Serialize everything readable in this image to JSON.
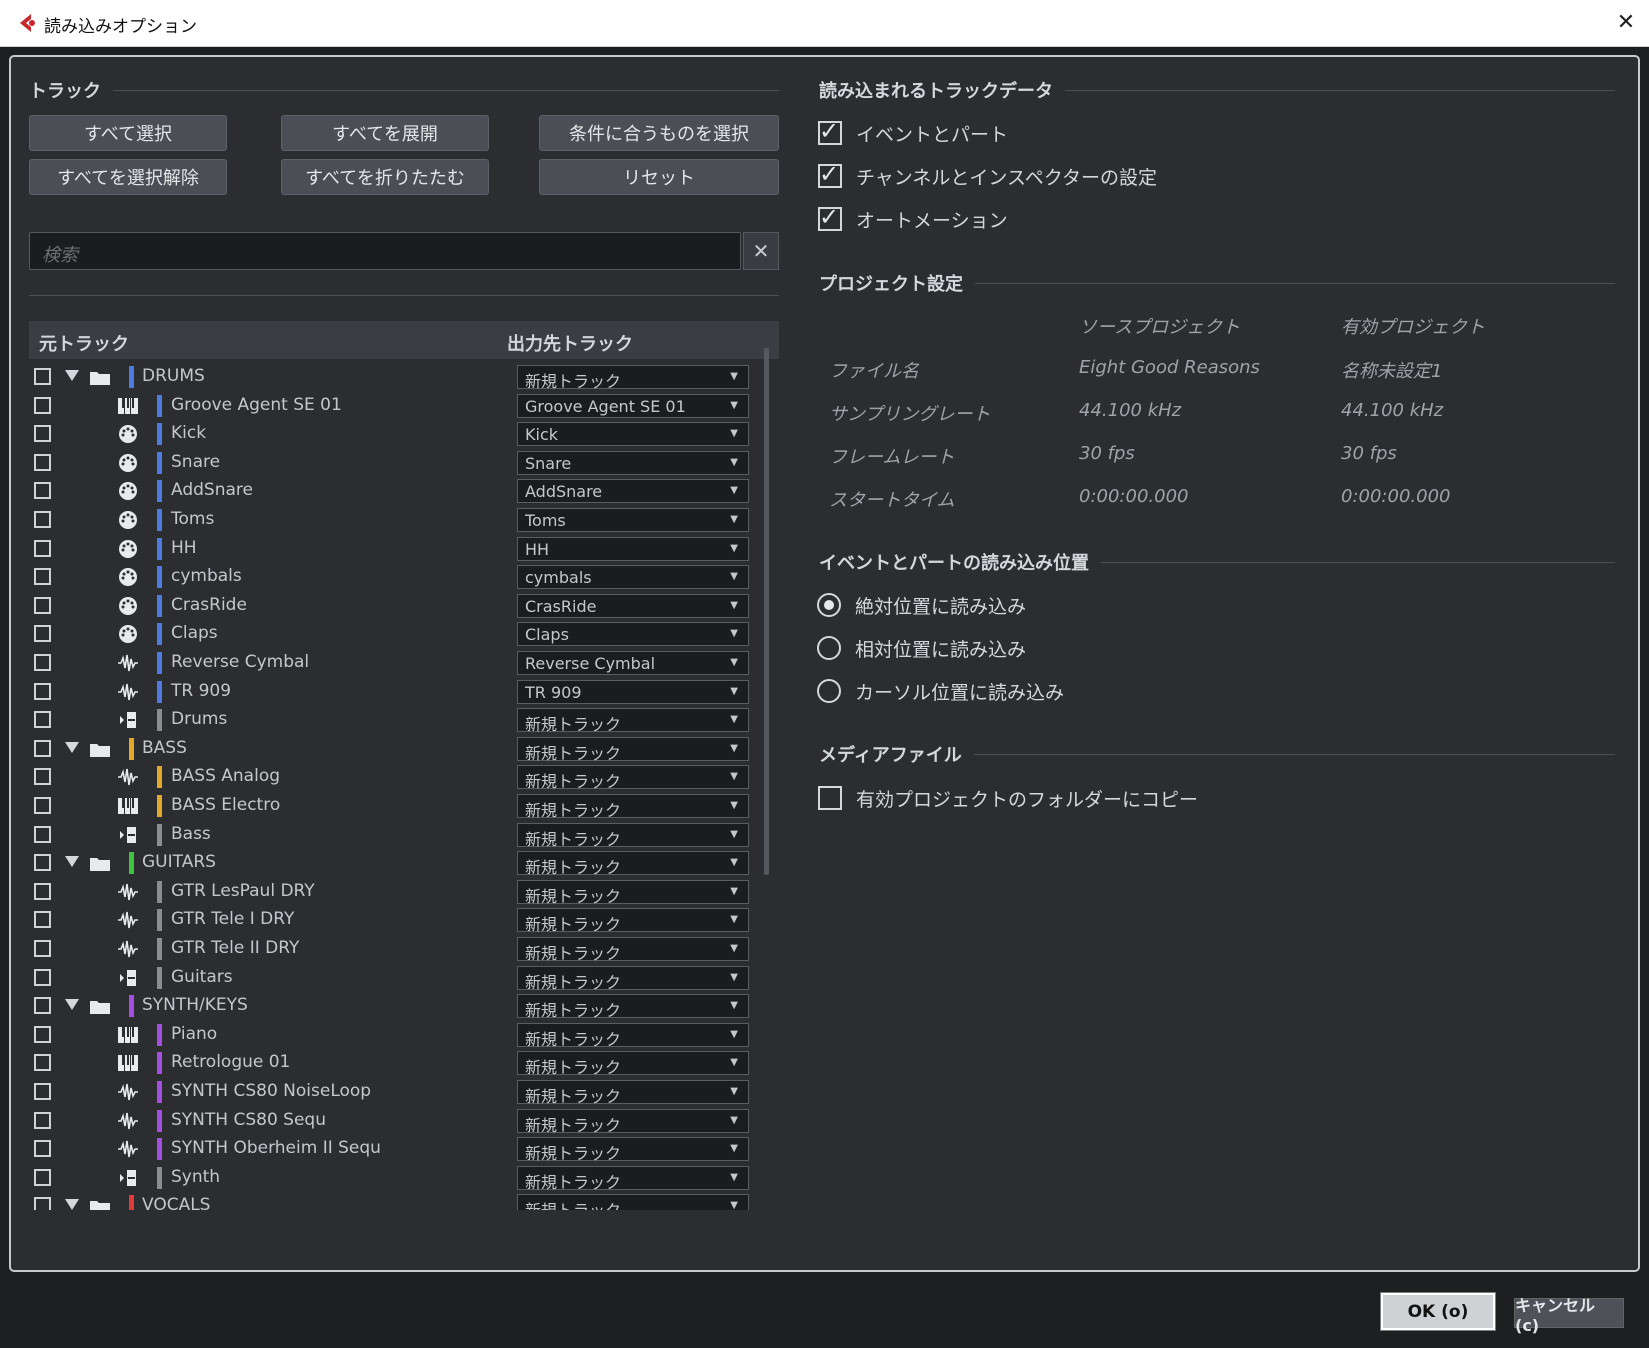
{
  "window": {
    "title": "読み込みオプション",
    "close_label": "✕"
  },
  "tracks_section": {
    "title": "トラック",
    "buttons": {
      "select_all": "すべて選択",
      "expand_all": "すべてを展開",
      "select_matching": "条件に合うものを選択",
      "deselect_all": "すべてを選択解除",
      "collapse_all": "すべてを折りたたむ",
      "reset": "リセット"
    },
    "search": {
      "placeholder": "検索",
      "clear_label": "✕"
    },
    "columns": {
      "source": "元トラック",
      "destination": "出力先トラック"
    },
    "rows": [
      {
        "name": "DRUMS",
        "type": "folder",
        "color": "#4f7be0",
        "dest": "新規トラック",
        "level": 0
      },
      {
        "name": "Groove Agent SE 01",
        "type": "instrument",
        "color": "#4f7be0",
        "dest": "Groove Agent SE 01",
        "level": 1
      },
      {
        "name": "Kick",
        "type": "drum",
        "color": "#4f7be0",
        "dest": "Kick",
        "level": 1
      },
      {
        "name": "Snare",
        "type": "drum",
        "color": "#4f7be0",
        "dest": "Snare",
        "level": 1
      },
      {
        "name": "AddSnare",
        "type": "drum",
        "color": "#4f7be0",
        "dest": "AddSnare",
        "level": 1
      },
      {
        "name": "Toms",
        "type": "drum",
        "color": "#4f7be0",
        "dest": "Toms",
        "level": 1
      },
      {
        "name": "HH",
        "type": "drum",
        "color": "#4f7be0",
        "dest": "HH",
        "level": 1
      },
      {
        "name": " cymbals",
        "type": "drum",
        "color": "#4f7be0",
        "dest": " cymbals",
        "level": 1
      },
      {
        "name": "CrasRide",
        "type": "drum",
        "color": "#4f7be0",
        "dest": "CrasRide",
        "level": 1
      },
      {
        "name": "Claps",
        "type": "drum",
        "color": "#4f7be0",
        "dest": "Claps",
        "level": 1
      },
      {
        "name": "Reverse Cymbal",
        "type": "audio",
        "color": "#4f7be0",
        "dest": "Reverse Cymbal",
        "level": 1
      },
      {
        "name": "TR 909",
        "type": "audio",
        "color": "#4f7be0",
        "dest": "TR 909",
        "level": 1
      },
      {
        "name": "Drums",
        "type": "group",
        "color": "#8a8d92",
        "dest": "新規トラック",
        "level": 1
      },
      {
        "name": "BASS",
        "type": "folder",
        "color": "#e0a92a",
        "dest": "新規トラック",
        "level": 0
      },
      {
        "name": "BASS Analog",
        "type": "audio",
        "color": "#e0a92a",
        "dest": "新規トラック",
        "level": 1
      },
      {
        "name": "BASS Electro",
        "type": "instrument",
        "color": "#e0a92a",
        "dest": "新規トラック",
        "level": 1
      },
      {
        "name": "Bass",
        "type": "group",
        "color": "#8a8d92",
        "dest": "新規トラック",
        "level": 1
      },
      {
        "name": "GUITARS",
        "type": "folder",
        "color": "#3fc43f",
        "dest": "新規トラック",
        "level": 0
      },
      {
        "name": "GTR LesPaul DRY",
        "type": "audio",
        "color": "#8a8d92",
        "dest": "新規トラック",
        "level": 1
      },
      {
        "name": "GTR Tele I DRY",
        "type": "audio",
        "color": "#8a8d92",
        "dest": "新規トラック",
        "level": 1
      },
      {
        "name": "GTR Tele II DRY",
        "type": "audio",
        "color": "#8a8d92",
        "dest": "新規トラック",
        "level": 1
      },
      {
        "name": "Guitars",
        "type": "group",
        "color": "#8a8d92",
        "dest": "新規トラック",
        "level": 1
      },
      {
        "name": "SYNTH/KEYS",
        "type": "folder",
        "color": "#a44fe0",
        "dest": "新規トラック",
        "level": 0
      },
      {
        "name": "Piano",
        "type": "instrument",
        "color": "#a44fe0",
        "dest": "新規トラック",
        "level": 1
      },
      {
        "name": "Retrologue 01",
        "type": "instrument",
        "color": "#a44fe0",
        "dest": "新規トラック",
        "level": 1
      },
      {
        "name": "SYNTH CS80 NoiseLoop",
        "type": "audio",
        "color": "#a44fe0",
        "dest": "新規トラック",
        "level": 1
      },
      {
        "name": "SYNTH CS80 Sequ",
        "type": "audio",
        "color": "#a44fe0",
        "dest": "新規トラック",
        "level": 1
      },
      {
        "name": "SYNTH Oberheim II Sequ",
        "type": "audio",
        "color": "#a44fe0",
        "dest": "新規トラック",
        "level": 1
      },
      {
        "name": "Synth",
        "type": "group",
        "color": "#8a8d92",
        "dest": "新規トラック",
        "level": 1
      },
      {
        "name": "VOCALS",
        "type": "folder",
        "color": "#e03a3a",
        "dest": "新規トラック",
        "level": 0
      }
    ]
  },
  "import_data": {
    "title": "読み込まれるトラックデータ",
    "options": [
      {
        "label": "イベントとパート",
        "checked": true
      },
      {
        "label": "チャンネルとインスペクターの設定",
        "checked": true
      },
      {
        "label": "オートメーション",
        "checked": true
      }
    ]
  },
  "project_settings": {
    "title": "プロジェクト設定",
    "col_source": "ソースプロジェクト",
    "col_active": "有効プロジェクト",
    "rows": [
      {
        "label": "ファイル名",
        "source": "Eight Good Reasons",
        "active": "名称未設定1"
      },
      {
        "label": "サンプリングレート",
        "source": "44.100 kHz",
        "active": "44.100 kHz"
      },
      {
        "label": "フレームレート",
        "source": "30 fps",
        "active": "30 fps"
      },
      {
        "label": "スタートタイム",
        "source": "0:00:00.000",
        "active": "0:00:00.000"
      }
    ]
  },
  "import_position": {
    "title": "イベントとパートの読み込み位置",
    "options": [
      {
        "label": "絶対位置に読み込み",
        "selected": true
      },
      {
        "label": "相対位置に読み込み",
        "selected": false
      },
      {
        "label": "カーソル位置に読み込み",
        "selected": false
      }
    ]
  },
  "media_files": {
    "title": "メディアファイル",
    "copy_label": "有効プロジェクトのフォルダーにコピー",
    "copy_checked": false
  },
  "footer": {
    "ok_label": "OK (o)",
    "cancel_label": "キャンセル (c)"
  }
}
